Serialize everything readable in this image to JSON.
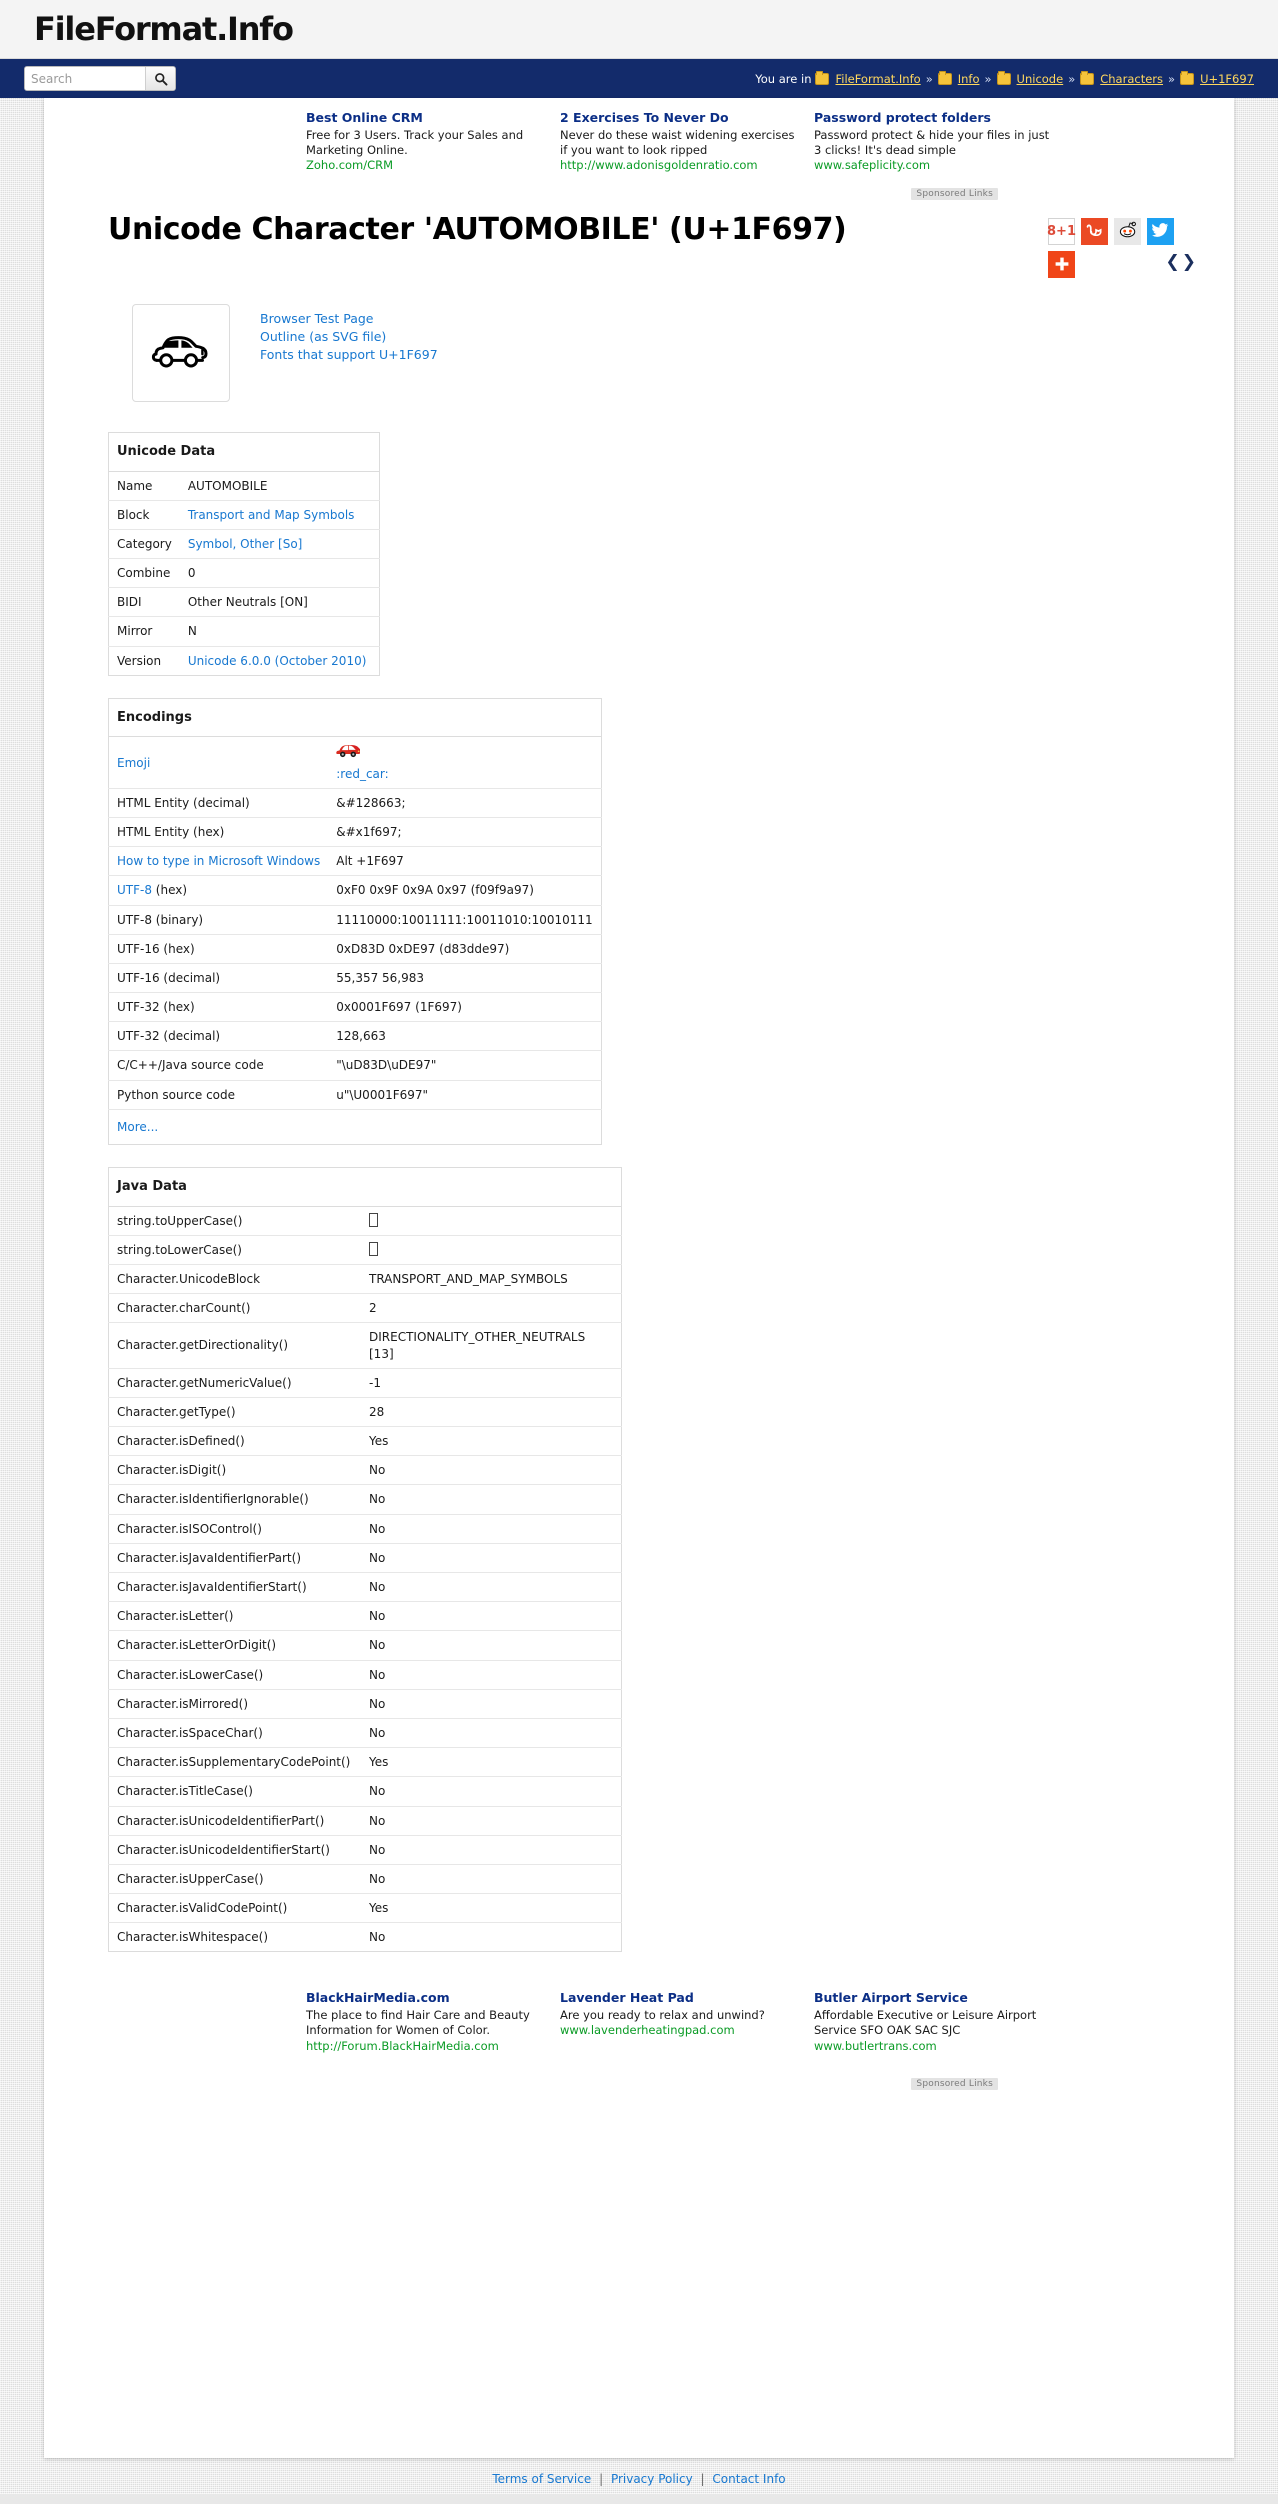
{
  "site": {
    "logo": "FileFormat.Info"
  },
  "search": {
    "placeholder": "Search",
    "value": "",
    "button_icon": "search-icon"
  },
  "breadcrumb": {
    "prefix": "You are in",
    "separator": "»",
    "items": [
      {
        "label": "FileFormat.Info"
      },
      {
        "label": "Info"
      },
      {
        "label": "Unicode"
      },
      {
        "label": "Characters"
      },
      {
        "label": "U+1F697"
      }
    ]
  },
  "ads_top": {
    "sponsored_label": "Sponsored Links",
    "items": [
      {
        "title": "Best Online CRM",
        "body": "Free for 3 Users. Track your Sales and Marketing Online.",
        "url": "Zoho.com/CRM"
      },
      {
        "title": "2 Exercises To Never Do",
        "body": "Never do these waist widening exercises if you want to look ripped",
        "url": "http://www.adonisgoldenratio.com"
      },
      {
        "title": "Password protect folders",
        "body": "Password protect & hide your files in just 3 clicks! It's dead simple",
        "url": "www.safeplicity.com"
      }
    ]
  },
  "page": {
    "title": "Unicode Character 'AUTOMOBILE' (U+1F697)"
  },
  "social": {
    "buttons": [
      {
        "name": "google-plus-one-button",
        "label": "g+1"
      },
      {
        "name": "stumbleupon-button",
        "label": "su"
      },
      {
        "name": "reddit-button",
        "label": ""
      },
      {
        "name": "twitter-button",
        "label": ""
      },
      {
        "name": "addthis-button",
        "label": "+"
      }
    ]
  },
  "pager": {
    "prev": "❮",
    "next": "❯"
  },
  "glyph": {
    "character_name": "automobile-glyph",
    "links": [
      {
        "label": "Browser Test Page"
      },
      {
        "label": "Outline (as SVG file)"
      },
      {
        "label": "Fonts that support U+1F697"
      }
    ]
  },
  "unicode_data": {
    "heading": "Unicode Data",
    "rows": [
      {
        "key": "Name",
        "value": "AUTOMOBILE",
        "link": false
      },
      {
        "key": "Block",
        "value": "Transport and Map Symbols",
        "link": true
      },
      {
        "key": "Category",
        "value": "Symbol, Other [So]",
        "link": true
      },
      {
        "key": "Combine",
        "value": "0",
        "link": false
      },
      {
        "key": "BIDI",
        "value": "Other Neutrals [ON]",
        "link": false
      },
      {
        "key": "Mirror",
        "value": "N",
        "link": false
      },
      {
        "key": "Version",
        "value": "Unicode 6.0.0 (October 2010)",
        "link": true
      }
    ]
  },
  "encodings": {
    "heading": "Encodings",
    "emoji_key": "Emoji",
    "emoji_value": ":red_car:",
    "rows": [
      {
        "key": "HTML Entity (decimal)",
        "key_link": false,
        "value": "&#128663;"
      },
      {
        "key": "HTML Entity (hex)",
        "key_link": false,
        "value": "&#x1f697;"
      },
      {
        "key": "How to type in Microsoft Windows",
        "key_link": true,
        "value": "Alt +1F697"
      },
      {
        "key": "UTF-8 (hex)",
        "key_link": true,
        "key_link_part": "UTF-8",
        "key_rest": " (hex)",
        "value": "0xF0 0x9F 0x9A 0x97 (f09f9a97)"
      },
      {
        "key": "UTF-8 (binary)",
        "key_link": false,
        "value": "11110000:10011111:10011010:10010111"
      },
      {
        "key": "UTF-16 (hex)",
        "key_link": false,
        "value": "0xD83D 0xDE97 (d83dde97)"
      },
      {
        "key": "UTF-16 (decimal)",
        "key_link": false,
        "value": "55,357 56,983"
      },
      {
        "key": "UTF-32 (hex)",
        "key_link": false,
        "value": "0x0001F697 (1F697)"
      },
      {
        "key": "UTF-32 (decimal)",
        "key_link": false,
        "value": "128,663"
      },
      {
        "key": "C/C++/Java source code",
        "key_link": false,
        "value": "\"\\uD83D\\uDE97\""
      },
      {
        "key": "Python source code",
        "key_link": false,
        "value": "u\"\\U0001F697\""
      }
    ],
    "more_label": "More..."
  },
  "java_data": {
    "heading": "Java Data",
    "rows": [
      {
        "key": "string.toUpperCase()",
        "value": "",
        "tofu": true
      },
      {
        "key": "string.toLowerCase()",
        "value": "",
        "tofu": true
      },
      {
        "key": "Character.UnicodeBlock",
        "value": "TRANSPORT_AND_MAP_SYMBOLS"
      },
      {
        "key": "Character.charCount()",
        "value": "2"
      },
      {
        "key": "Character.getDirectionality()",
        "value": "DIRECTIONALITY_OTHER_NEUTRALS [13]"
      },
      {
        "key": "Character.getNumericValue()",
        "value": "-1"
      },
      {
        "key": "Character.getType()",
        "value": "28"
      },
      {
        "key": "Character.isDefined()",
        "value": "Yes"
      },
      {
        "key": "Character.isDigit()",
        "value": "No"
      },
      {
        "key": "Character.isIdentifierIgnorable()",
        "value": "No"
      },
      {
        "key": "Character.isISOControl()",
        "value": "No"
      },
      {
        "key": "Character.isJavaIdentifierPart()",
        "value": "No"
      },
      {
        "key": "Character.isJavaIdentifierStart()",
        "value": "No"
      },
      {
        "key": "Character.isLetter()",
        "value": "No"
      },
      {
        "key": "Character.isLetterOrDigit()",
        "value": "No"
      },
      {
        "key": "Character.isLowerCase()",
        "value": "No"
      },
      {
        "key": "Character.isMirrored()",
        "value": "No"
      },
      {
        "key": "Character.isSpaceChar()",
        "value": "No"
      },
      {
        "key": "Character.isSupplementaryCodePoint()",
        "value": "Yes"
      },
      {
        "key": "Character.isTitleCase()",
        "value": "No"
      },
      {
        "key": "Character.isUnicodeIdentifierPart()",
        "value": "No"
      },
      {
        "key": "Character.isUnicodeIdentifierStart()",
        "value": "No"
      },
      {
        "key": "Character.isUpperCase()",
        "value": "No"
      },
      {
        "key": "Character.isValidCodePoint()",
        "value": "Yes"
      },
      {
        "key": "Character.isWhitespace()",
        "value": "No"
      }
    ]
  },
  "ads_bottom": {
    "sponsored_label": "Sponsored Links",
    "items": [
      {
        "title": "BlackHairMedia.com",
        "body": "The place to find Hair Care and Beauty Information for Women of Color.",
        "url": "http://Forum.BlackHairMedia.com"
      },
      {
        "title": "Lavender Heat Pad",
        "body": "Are you ready to relax and unwind?",
        "url": "www.lavenderheatingpad.com"
      },
      {
        "title": "Butler Airport Service",
        "body": "Affordable Executive or Leisure Airport Service SFO OAK SAC SJC",
        "url": "www.butlertrans.com"
      }
    ]
  },
  "footer": {
    "links": [
      {
        "label": "Terms of Service"
      },
      {
        "label": "Privacy Policy"
      },
      {
        "label": "Contact Info"
      }
    ],
    "separator": "|"
  },
  "colors": {
    "navy": "#132b6b",
    "link_blue": "#1878d0",
    "ad_title_blue": "#0b2e86",
    "ad_url_green": "#0a9b25",
    "breadcrumb_yellow": "#ffd85e"
  }
}
